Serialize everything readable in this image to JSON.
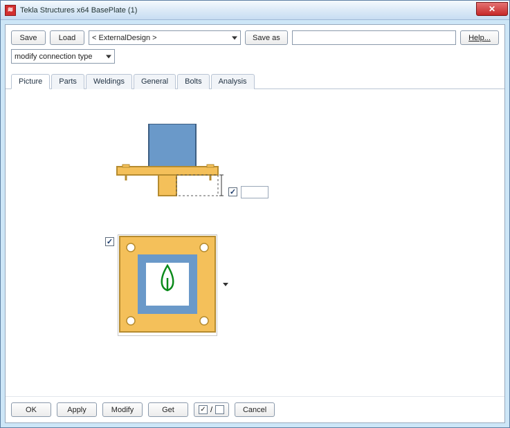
{
  "window": {
    "title": "Tekla Structures x64  BasePlate (1)"
  },
  "toolbar": {
    "save": "Save",
    "load": "Load",
    "design_combo": "< ExternalDesign >",
    "save_as": "Save as",
    "name_value": "",
    "help": "Help..."
  },
  "row2": {
    "modify_type": "modify connection type"
  },
  "tabs": [
    "Picture",
    "Parts",
    "Weldings",
    "General",
    "Bolts",
    "Analysis"
  ],
  "active_tab": 0,
  "picture": {
    "check_right": true,
    "input_right": "",
    "check_left": true
  },
  "bottom": {
    "ok": "OK",
    "apply": "Apply",
    "modify": "Modify",
    "get": "Get",
    "cancel": "Cancel",
    "toggle_on": "☑",
    "toggle_mid": "/",
    "toggle_off": "☐"
  }
}
